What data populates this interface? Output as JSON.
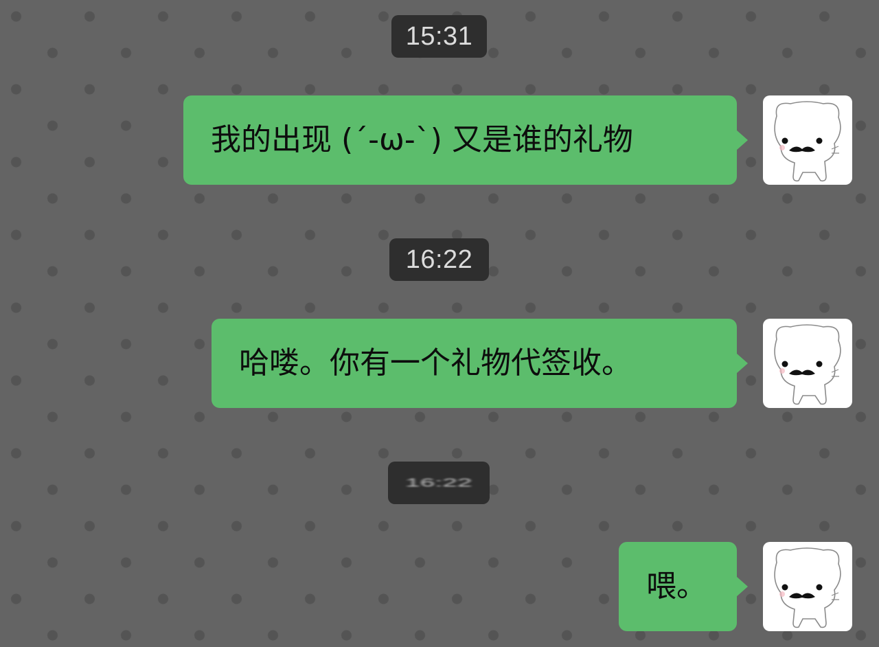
{
  "timestamps": [
    "15:31",
    "16:22",
    "16:22"
  ],
  "messages": [
    {
      "text": "我的出现 (´-ω-`) 又是谁的礼物",
      "sender": "me",
      "avatar_icon": "white-cat-mustache-avatar-icon"
    },
    {
      "text": "哈喽。你有一个礼物代签收。",
      "sender": "me",
      "avatar_icon": "white-cat-mustache-avatar-icon"
    },
    {
      "text": "喂。",
      "sender": "me",
      "avatar_icon": "white-cat-mustache-avatar-icon"
    }
  ],
  "colors": {
    "background": "#646464",
    "dot": "#545454",
    "bubble": "#5cbd6c",
    "time_pill": "#2e2e2e"
  }
}
